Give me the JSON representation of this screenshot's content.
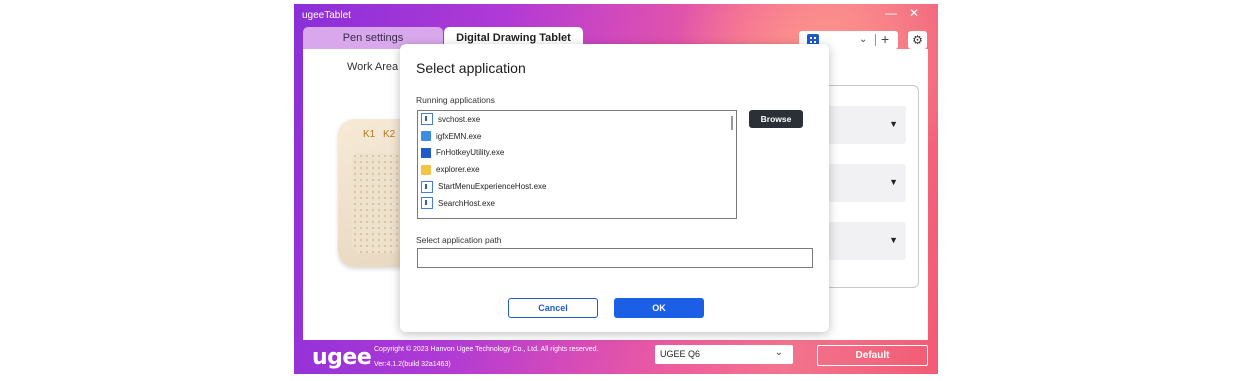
{
  "window": {
    "title": "ugeeTablet",
    "minimize": "—",
    "close": "✕"
  },
  "tabs": [
    {
      "label": "Pen settings"
    },
    {
      "label": "Digital Drawing Tablet"
    }
  ],
  "top_controls": {
    "app_chevron": "⌄",
    "add": "+",
    "settings": "⚙"
  },
  "main": {
    "work_area_label": "Work Area",
    "keys": [
      "K1",
      "K2"
    ],
    "dropdown_arrow": "▼"
  },
  "dialog": {
    "title": "Select application",
    "running_label": "Running applications",
    "apps": [
      {
        "name": "svchost.exe",
        "icon": "exe-icon"
      },
      {
        "name": "igfxEMN.exe",
        "icon": "igfx-icon"
      },
      {
        "name": "FnHotkeyUtility.exe",
        "icon": "fn-icon"
      },
      {
        "name": "explorer.exe",
        "icon": "folder-icon"
      },
      {
        "name": "StartMenuExperienceHost.exe",
        "icon": "exe-icon"
      },
      {
        "name": "SearchHost.exe",
        "icon": "exe-icon"
      }
    ],
    "browse_label": "Browse",
    "path_label": "Select application path",
    "path_value": "",
    "cancel_label": "Cancel",
    "ok_label": "OK"
  },
  "footer": {
    "logo": "ugee",
    "copyright": "Copyright © 2023 Hanvon Ugee Technology Co., Ltd. All rights reserved.",
    "version": "Ver:4.1.2(build 32a1463)",
    "device": "UGEE Q6",
    "device_chevron": "⌄",
    "default_label": "Default"
  },
  "colors": {
    "accent": "#1a5fe6",
    "browse_bg": "#2b3036",
    "gradient_start": "#8a2fd8",
    "gradient_end": "#f25b73"
  }
}
